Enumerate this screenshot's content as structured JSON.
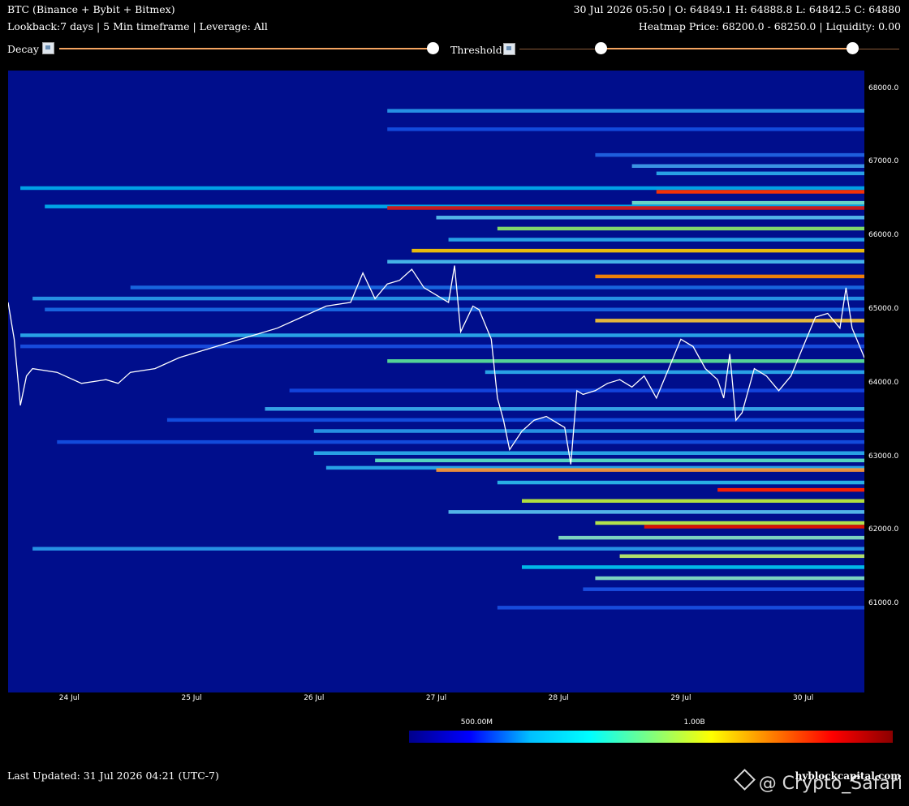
{
  "header": {
    "title": "BTC (Binance + Bybit + Bitmex)",
    "ohlc": "30 Jul 2026 05:50 | O: 64849.1 H: 64888.8 L: 64842.5 C: 64880",
    "subtitle": "Lookback:7 days | 5 Min timeframe | Leverage: All",
    "heatmap_info": "Heatmap Price: 68200.0 - 68250.0 | Liquidity: 0.00"
  },
  "controls": {
    "decay_label": "Decay",
    "threshold_label": "Threshold",
    "decay_value": 1.0,
    "threshold_range": [
      0.2,
      0.88
    ],
    "track_color": "#f4a460"
  },
  "footer": {
    "last_updated": "Last Updated: 31 Jul 2026 04:21 (UTC-7)",
    "site": "hyblockcapital.com",
    "watermark": "@ Crypto_Safari"
  },
  "colorbar": {
    "labels": [
      {
        "text": "500.00M",
        "frac": 0.14
      },
      {
        "text": "1.00B",
        "frac": 0.59
      }
    ],
    "stops": [
      "#00008b",
      "#0000ff",
      "#00bfff",
      "#00ffff",
      "#7fff7f",
      "#ffff00",
      "#ff7f00",
      "#ff0000",
      "#8b0000"
    ]
  },
  "chart_data": {
    "type": "heatmap",
    "y_range": [
      59800,
      68250
    ],
    "x_range": [
      "23 Jul 12:00",
      "30 Jul 12:00"
    ],
    "x_ticks": [
      "24 Jul",
      "25 Jul",
      "26 Jul",
      "27 Jul",
      "28 Jul",
      "29 Jul",
      "30 Jul"
    ],
    "y_ticks": [
      61000,
      62000,
      63000,
      64000,
      65000,
      66000,
      67000,
      68000
    ],
    "y_tick_labels": [
      "61000.0",
      "62000.0",
      "63000.0",
      "64000.0",
      "65000.0",
      "66000.0",
      "67000.0",
      "68000.0"
    ],
    "background_color": "#000e8c",
    "price_series": [
      [
        0.0,
        65100
      ],
      [
        0.05,
        64600
      ],
      [
        0.1,
        63700
      ],
      [
        0.15,
        64100
      ],
      [
        0.2,
        64200
      ],
      [
        0.4,
        64150
      ],
      [
        0.6,
        64000
      ],
      [
        0.8,
        64050
      ],
      [
        0.9,
        64000
      ],
      [
        1.0,
        64150
      ],
      [
        1.2,
        64200
      ],
      [
        1.4,
        64350
      ],
      [
        1.6,
        64450
      ],
      [
        1.8,
        64550
      ],
      [
        2.0,
        64650
      ],
      [
        2.2,
        64750
      ],
      [
        2.4,
        64900
      ],
      [
        2.6,
        65050
      ],
      [
        2.8,
        65100
      ],
      [
        2.9,
        65500
      ],
      [
        3.0,
        65150
      ],
      [
        3.1,
        65350
      ],
      [
        3.2,
        65400
      ],
      [
        3.3,
        65550
      ],
      [
        3.4,
        65300
      ],
      [
        3.5,
        65200
      ],
      [
        3.6,
        65100
      ],
      [
        3.65,
        65600
      ],
      [
        3.7,
        64700
      ],
      [
        3.8,
        65050
      ],
      [
        3.85,
        65000
      ],
      [
        3.95,
        64600
      ],
      [
        4.0,
        63800
      ],
      [
        4.05,
        63500
      ],
      [
        4.1,
        63100
      ],
      [
        4.2,
        63350
      ],
      [
        4.3,
        63500
      ],
      [
        4.4,
        63550
      ],
      [
        4.5,
        63450
      ],
      [
        4.55,
        63400
      ],
      [
        4.6,
        62900
      ],
      [
        4.65,
        63900
      ],
      [
        4.7,
        63850
      ],
      [
        4.8,
        63900
      ],
      [
        4.9,
        64000
      ],
      [
        5.0,
        64050
      ],
      [
        5.1,
        63950
      ],
      [
        5.2,
        64100
      ],
      [
        5.3,
        63800
      ],
      [
        5.4,
        64200
      ],
      [
        5.5,
        64600
      ],
      [
        5.6,
        64500
      ],
      [
        5.7,
        64200
      ],
      [
        5.8,
        64050
      ],
      [
        5.85,
        63800
      ],
      [
        5.9,
        64400
      ],
      [
        5.95,
        63500
      ],
      [
        6.0,
        63600
      ],
      [
        6.1,
        64200
      ],
      [
        6.2,
        64100
      ],
      [
        6.3,
        63900
      ],
      [
        6.4,
        64100
      ],
      [
        6.5,
        64500
      ],
      [
        6.6,
        64900
      ],
      [
        6.7,
        64950
      ],
      [
        6.8,
        64750
      ],
      [
        6.85,
        65300
      ],
      [
        6.9,
        64750
      ],
      [
        7.0,
        64350
      ],
      [
        7.05,
        64200
      ],
      [
        7.1,
        64400
      ],
      [
        7.15,
        63950
      ],
      [
        7.2,
        63750
      ],
      [
        7.25,
        63600
      ],
      [
        7.3,
        63800
      ],
      [
        7.35,
        64000
      ]
    ],
    "liquidity_bands": [
      {
        "price": 67700,
        "x_start": 3.1,
        "color": "#33bbff",
        "level": 0.45
      },
      {
        "price": 67450,
        "x_start": 3.1,
        "color": "#1a66ff",
        "level": 0.3
      },
      {
        "price": 67100,
        "x_start": 4.8,
        "color": "#2a7fff",
        "level": 0.35
      },
      {
        "price": 66950,
        "x_start": 5.1,
        "color": "#4fbfff",
        "level": 0.45
      },
      {
        "price": 66850,
        "x_start": 5.3,
        "color": "#33ccff",
        "level": 0.5
      },
      {
        "price": 66650,
        "x_start": 0.1,
        "color": "#00ccff",
        "level": 0.5
      },
      {
        "price": 66600,
        "x_start": 5.3,
        "color": "#ff3300",
        "level": 0.9
      },
      {
        "price": 66450,
        "x_start": 5.1,
        "color": "#7fffd4",
        "level": 0.6
      },
      {
        "price": 66400,
        "x_start": 0.3,
        "color": "#00ccff",
        "level": 0.55
      },
      {
        "price": 66380,
        "x_start": 3.1,
        "color": "#cc1a1a",
        "level": 0.95
      },
      {
        "price": 66250,
        "x_start": 3.5,
        "color": "#66e0ff",
        "level": 0.55
      },
      {
        "price": 66100,
        "x_start": 4.0,
        "color": "#99ff66",
        "level": 0.65
      },
      {
        "price": 65950,
        "x_start": 3.6,
        "color": "#33ccff",
        "level": 0.5
      },
      {
        "price": 65800,
        "x_start": 3.3,
        "color": "#ffcc00",
        "level": 0.8
      },
      {
        "price": 65650,
        "x_start": 3.1,
        "color": "#55ddff",
        "level": 0.55
      },
      {
        "price": 65450,
        "x_start": 4.8,
        "color": "#ff8800",
        "level": 0.85
      },
      {
        "price": 65300,
        "x_start": 1.0,
        "color": "#2288ff",
        "level": 0.35
      },
      {
        "price": 65150,
        "x_start": 0.2,
        "color": "#33bbff",
        "level": 0.45
      },
      {
        "price": 65000,
        "x_start": 0.3,
        "color": "#2288ff",
        "level": 0.35
      },
      {
        "price": 64850,
        "x_start": 4.8,
        "color": "#ffcc33",
        "level": 0.75
      },
      {
        "price": 64650,
        "x_start": 0.1,
        "color": "#33ccff",
        "level": 0.5
      },
      {
        "price": 64500,
        "x_start": 0.1,
        "color": "#2266ff",
        "level": 0.3
      },
      {
        "price": 64300,
        "x_start": 3.1,
        "color": "#66ff99",
        "level": 0.6
      },
      {
        "price": 64150,
        "x_start": 3.9,
        "color": "#33ccff",
        "level": 0.5
      },
      {
        "price": 63900,
        "x_start": 2.3,
        "color": "#1a5cff",
        "level": 0.3
      },
      {
        "price": 63650,
        "x_start": 2.1,
        "color": "#44ccff",
        "level": 0.5
      },
      {
        "price": 63500,
        "x_start": 1.3,
        "color": "#1a66ff",
        "level": 0.35
      },
      {
        "price": 63350,
        "x_start": 2.5,
        "color": "#33bbff",
        "level": 0.45
      },
      {
        "price": 63200,
        "x_start": 0.4,
        "color": "#1a66ff",
        "level": 0.3
      },
      {
        "price": 63050,
        "x_start": 2.5,
        "color": "#33ccff",
        "level": 0.5
      },
      {
        "price": 62950,
        "x_start": 3.0,
        "color": "#66ffcc",
        "level": 0.6
      },
      {
        "price": 62850,
        "x_start": 2.6,
        "color": "#33ccff",
        "level": 0.5
      },
      {
        "price": 62820,
        "x_start": 3.5,
        "color": "#ff9933",
        "level": 0.8
      },
      {
        "price": 62650,
        "x_start": 4.0,
        "color": "#33ddff",
        "level": 0.5
      },
      {
        "price": 62550,
        "x_start": 5.8,
        "color": "#ff2200",
        "level": 0.92
      },
      {
        "price": 62400,
        "x_start": 4.2,
        "color": "#ccff33",
        "level": 0.7
      },
      {
        "price": 62250,
        "x_start": 3.6,
        "color": "#66e0ff",
        "level": 0.55
      },
      {
        "price": 62100,
        "x_start": 4.8,
        "color": "#ccff44",
        "level": 0.72
      },
      {
        "price": 62050,
        "x_start": 5.2,
        "color": "#dd1100",
        "level": 0.95
      },
      {
        "price": 61900,
        "x_start": 4.5,
        "color": "#99ffcc",
        "level": 0.6
      },
      {
        "price": 61750,
        "x_start": 0.2,
        "color": "#33bbff",
        "level": 0.45
      },
      {
        "price": 61650,
        "x_start": 5.0,
        "color": "#ccff66",
        "level": 0.7
      },
      {
        "price": 61500,
        "x_start": 4.2,
        "color": "#00e5ff",
        "level": 0.55
      },
      {
        "price": 61350,
        "x_start": 4.8,
        "color": "#99ffcc",
        "level": 0.6
      },
      {
        "price": 61200,
        "x_start": 4.7,
        "color": "#2266ff",
        "level": 0.35
      },
      {
        "price": 60950,
        "x_start": 4.0,
        "color": "#2266ff",
        "level": 0.3
      }
    ]
  }
}
